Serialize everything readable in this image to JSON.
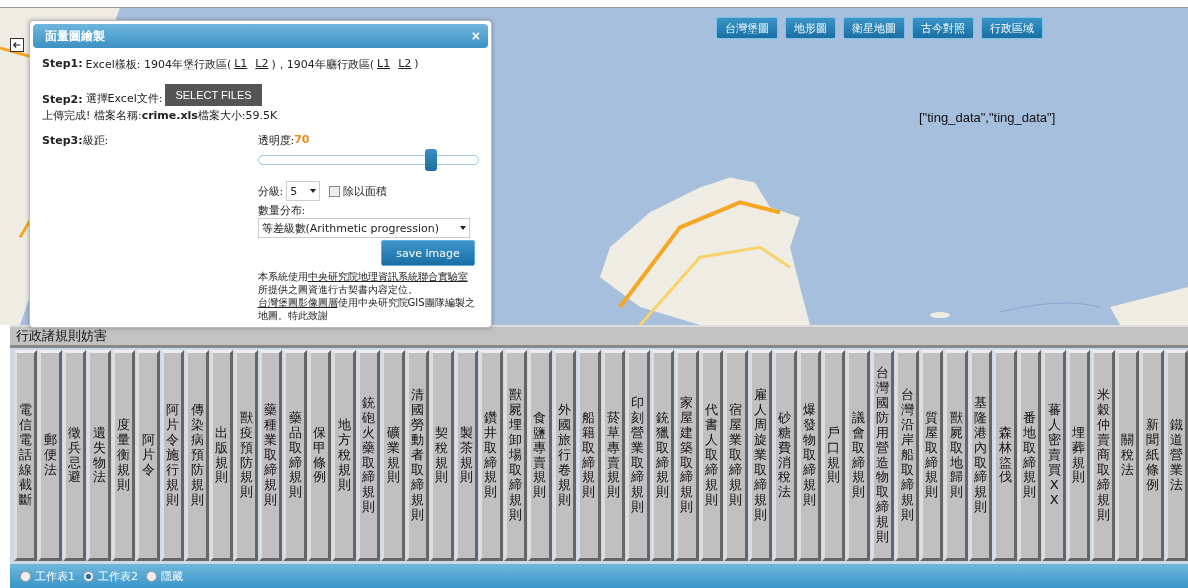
{
  "map_buttons": [
    {
      "label": "台灣堡圖"
    },
    {
      "label": "地形圖"
    },
    {
      "label": "衛星地圖"
    },
    {
      "label": "古今對照"
    },
    {
      "label": "行政區域"
    }
  ],
  "map_overlay_text": "[\"ting_data\",\"ting_data\"]",
  "dialog": {
    "title": "面量圖繪製",
    "close": "×",
    "step1": {
      "label": "Step1:",
      "text": "Excel樣板: 1904年堡行政區(",
      "links_a": [
        "L1",
        "L2"
      ],
      "middle": ")，1904年廳行政區(",
      "links_b": [
        "L1",
        "L2"
      ],
      "end": ")"
    },
    "step2": {
      "label": "Step2:",
      "text": "選擇Excel文件:",
      "button": "SELECT FILES",
      "status": "上傳完成! 檔案名稱:**crime.xls**檔案大小:59.5K"
    },
    "step3": {
      "label": "Step3:",
      "text": "級距:",
      "opacity_label": "透明度:",
      "opacity_value": "70",
      "opacity": {
        "level": 0.79
      },
      "classes_label": "分級:",
      "classes_value": "5",
      "divide_by_area": {
        "label": "除以面積",
        "checked": false
      },
      "distribution_label": "數量分布:",
      "distribution_value": "等差級數(Arithmetic progression)",
      "save": "save image"
    },
    "credits": [
      {
        "text": "本系統使用",
        "link": false
      },
      {
        "text": "中央研究院地理資訊系統聯合實驗室",
        "link": true
      },
      {
        "text": " 所提供之圖資進行古契書內容定位。",
        "link": false
      },
      {
        "text": "台灣堡圖影像圖層",
        "link": true
      },
      {
        "text": "使用中央研究院GIS團隊編製之地圖。特此致謝",
        "link": false
      }
    ]
  },
  "table": {
    "title": "行政諸規則妨害",
    "columns": [
      "電信電話線截斷",
      "郵便法",
      "徵兵忌避",
      "遺失物法",
      "度量衡規則",
      "阿片令",
      "阿片令施行規則",
      "傳染病預防規則",
      "出版規則",
      "獸疫預防規則",
      "藥種業取締規則",
      "藥品取締規則",
      "保甲條例",
      "地方稅規則",
      "銃砲火藥取締規則",
      "礦業規則",
      "清國勞動者取締規則",
      "契稅規則",
      "製茶規則",
      "鑽井取締規則",
      "獸屍埋卸場取締規則",
      "食鹽專賣規則",
      "外國旅行卷規則",
      "船籍取締規則",
      "菸草專賣規則",
      "印刻營業取締規則",
      "銃獵取締規則",
      "家屋建築取締規則",
      "代書人取締規則",
      "宿屋業取締規則",
      "雇人周旋業取締規則",
      "砂糖費消稅法",
      "爆發物取締規則",
      "戶口規則",
      "議會取締規則",
      "台灣國防用營造物取締規則",
      "台灣沿岸船取締規則",
      "質屋取締規則",
      "獸屍取地歸則",
      "基隆港內取締規則",
      "森林盜伐",
      "番地取締規則",
      "蕃人密賣買XX",
      "埋葬規則",
      "米穀仲賣商取締規則",
      "關稅法",
      "新聞紙條例",
      "鐵道營業法"
    ]
  },
  "sheets": [
    {
      "label": "工作表1",
      "selected": false
    },
    {
      "label": "工作表2",
      "selected": true
    },
    {
      "label": "隱藏",
      "selected": false
    }
  ]
}
